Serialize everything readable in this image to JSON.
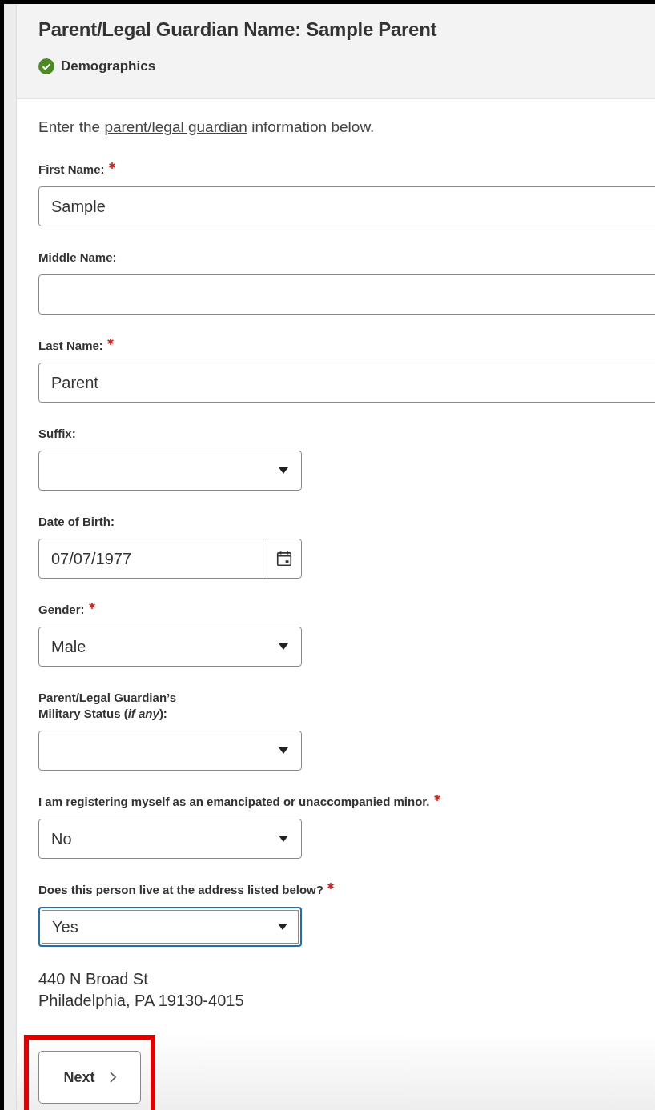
{
  "header": {
    "title": "Parent/Legal Guardian Name: Sample Parent",
    "step": {
      "label": "Demographics",
      "complete": true
    }
  },
  "intro_parts": [
    {
      "text": "Enter the ",
      "link": false
    },
    {
      "text": "parent/legal guardian",
      "link": true
    },
    {
      "text": " information below.",
      "link": false
    }
  ],
  "fields": [
    {
      "kind": "text",
      "label": "First Name:",
      "required": true,
      "value": "Sample",
      "wide": true,
      "focused": false
    },
    {
      "kind": "text",
      "label": "Middle Name:",
      "required": false,
      "wide": true,
      "focused": false
    },
    {
      "kind": "text",
      "label": "Last Name:",
      "required": true,
      "value": "Parent",
      "wide": true,
      "focused": false
    },
    {
      "kind": "select",
      "label": "Suffix:",
      "required": false,
      "wide": false,
      "focused": false
    },
    {
      "kind": "date",
      "label": "Date of Birth:",
      "required": false,
      "value": "07/07/1977",
      "wide": false,
      "focused": false
    },
    {
      "kind": "select",
      "label": "Gender:",
      "required": true,
      "value": "Male",
      "wide": false,
      "focused": false
    },
    {
      "kind": "select",
      "label": "Parent/Legal Guardian’s\nMilitary Status (*if any*):",
      "required": false,
      "wide": false,
      "focused": false
    },
    {
      "kind": "select",
      "label": "I am registering myself as an emancipated or unaccompanied minor.",
      "required": true,
      "value": "No",
      "wide": false,
      "focused": false
    },
    {
      "kind": "select",
      "label": "Does this person live at the address listed below?",
      "required": true,
      "value": "Yes",
      "wide": false,
      "focused": true
    }
  ],
  "address": [
    "440 N Broad St",
    "Philadelphia, PA 19130-4015"
  ],
  "next_button": {
    "label": "Next",
    "highlighted": true
  }
}
